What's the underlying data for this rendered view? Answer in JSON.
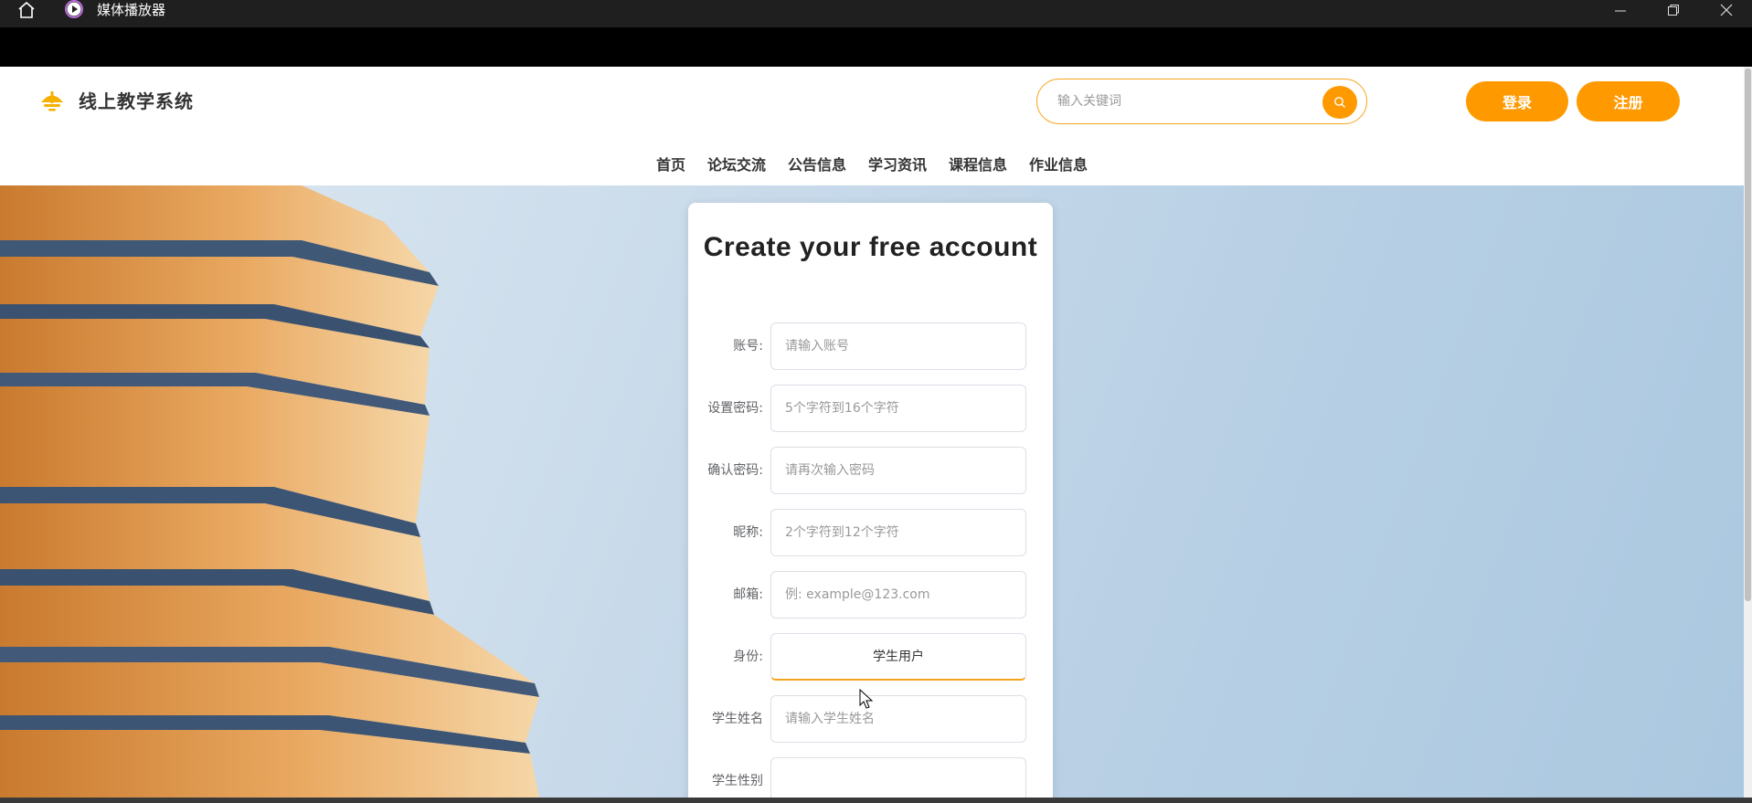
{
  "window": {
    "title": "媒体播放器"
  },
  "header": {
    "brand": "线上教学系统",
    "search_placeholder": "输入关键词",
    "login_label": "登录",
    "register_label": "注册"
  },
  "nav": {
    "items": [
      {
        "label": "首页"
      },
      {
        "label": "论坛交流"
      },
      {
        "label": "公告信息"
      },
      {
        "label": "学习资讯"
      },
      {
        "label": "课程信息"
      },
      {
        "label": "作业信息"
      }
    ]
  },
  "form": {
    "title": "Create your free account",
    "fields": [
      {
        "label": "账号:",
        "placeholder": "请输入账号",
        "value": ""
      },
      {
        "label": "设置密码:",
        "placeholder": "5个字符到16个字符",
        "value": ""
      },
      {
        "label": "确认密码:",
        "placeholder": "请再次输入密码",
        "value": ""
      },
      {
        "label": "昵称:",
        "placeholder": "2个字符到12个字符",
        "value": ""
      },
      {
        "label": "邮箱:",
        "placeholder": "例: example@123.com",
        "value": ""
      }
    ],
    "identity": {
      "label": "身份:",
      "value": "学生用户"
    },
    "student_name": {
      "label": "学生姓名",
      "placeholder": "请输入学生姓名",
      "value": ""
    },
    "student_gender": {
      "label": "学生性别",
      "placeholder": "",
      "value": ""
    }
  },
  "colors": {
    "accent": "#ff9900",
    "titlebar": "#1f1f1f",
    "text": "#333333"
  }
}
